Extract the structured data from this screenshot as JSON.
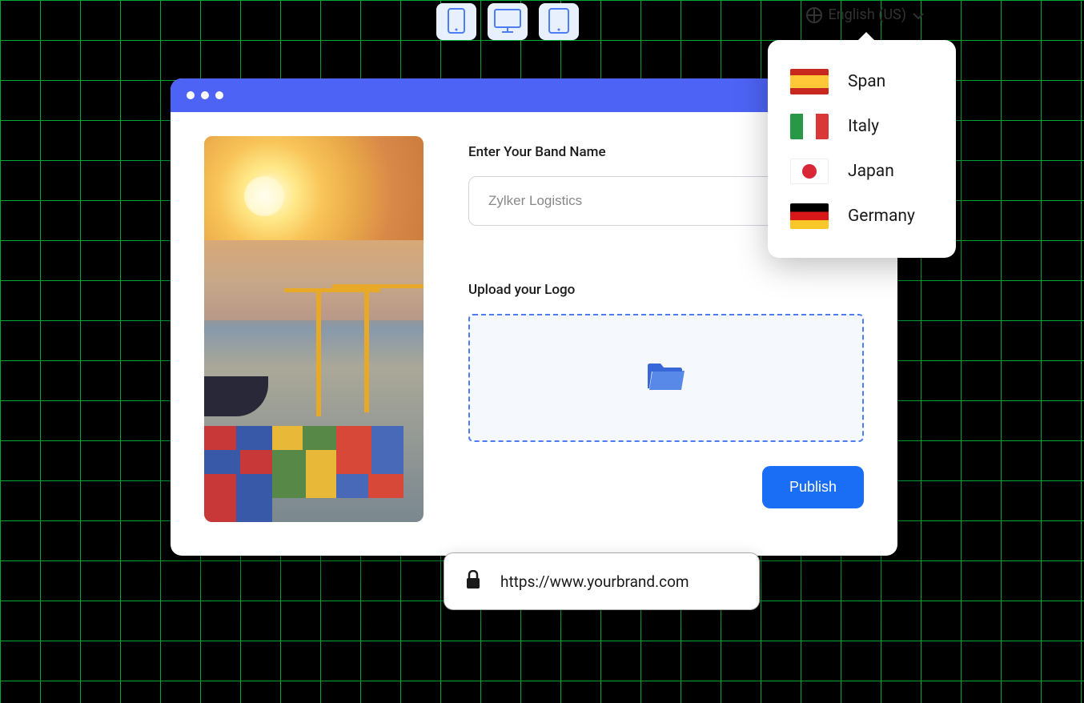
{
  "toolbar": {
    "language_selector": {
      "current": "English (US)"
    }
  },
  "form": {
    "brand_name_label": "Enter Your Band Name",
    "brand_name_placeholder": "Zylker Logistics",
    "upload_label": "Upload your Logo",
    "publish_button": "Publish"
  },
  "language_dropdown": {
    "items": [
      {
        "label": "Span",
        "flag": "es"
      },
      {
        "label": "Italy",
        "flag": "it"
      },
      {
        "label": "Japan",
        "flag": "jp"
      },
      {
        "label": "Germany",
        "flag": "de"
      }
    ]
  },
  "url_bar": {
    "url": "https://www.yourbrand.com"
  },
  "colors": {
    "accent": "#4d63f5",
    "primary_button": "#1a6df5",
    "grid": "#00a838"
  }
}
